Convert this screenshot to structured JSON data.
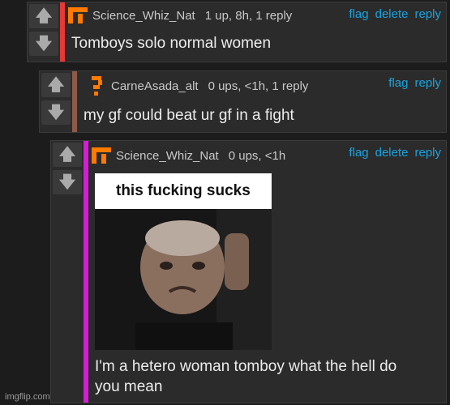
{
  "comments": [
    {
      "user": "Science_Whiz_Nat",
      "meta": "1 up, 8h, 1 reply",
      "text": "Tomboys solo normal women",
      "actions": [
        "flag",
        "delete",
        "reply"
      ],
      "bar_color": "#e53935"
    },
    {
      "user": "CarneAsada_alt",
      "meta": "0 ups, <1h, 1 reply",
      "text": "my gf could beat ur gf in a fight",
      "actions": [
        "flag",
        "reply"
      ],
      "bar_color": "#8d5a4a"
    },
    {
      "user": "Science_Whiz_Nat",
      "meta": "0 ups, <1h",
      "text": "I'm a hetero woman tomboy what the hell do you mean",
      "text_line1": "I'm a hetero woman tomboy what the hell do",
      "text_line2": "you mean",
      "actions": [
        "flag",
        "delete",
        "reply"
      ],
      "bar_color": "#d81bd8",
      "meme_caption": "this fucking sucks"
    }
  ],
  "watermark": "imgflip.com",
  "colors": {
    "accent": "#1aa3e0",
    "avatar_orange": "#ff7a00",
    "background": "#1c1c1c"
  }
}
